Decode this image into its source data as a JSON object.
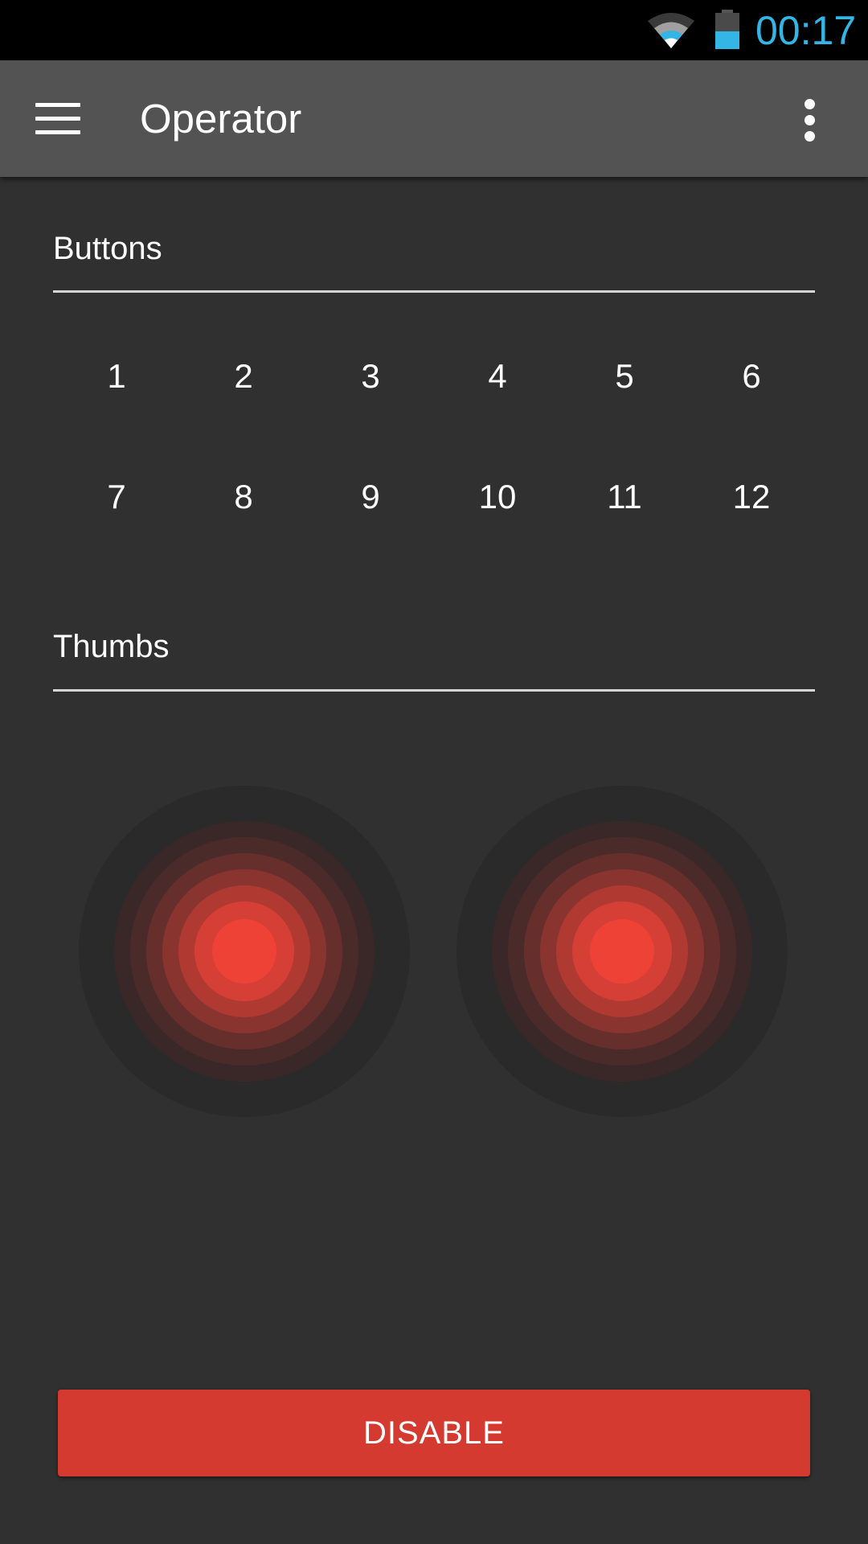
{
  "status_bar": {
    "time": "00:17",
    "icons": [
      "wifi-icon",
      "battery-icon"
    ],
    "accent_color": "#33b5e5"
  },
  "app_bar": {
    "title": "Operator",
    "menu_icon": "hamburger-menu-icon",
    "overflow_icon": "more-vert-icon"
  },
  "buttons_section": {
    "title": "Buttons",
    "buttons": [
      "1",
      "2",
      "3",
      "4",
      "5",
      "6",
      "7",
      "8",
      "9",
      "10",
      "11",
      "12"
    ]
  },
  "thumbs_section": {
    "title": "Thumbs",
    "thumbs": [
      "left-thumbstick",
      "right-thumbstick"
    ],
    "thumb_color": "#f44336"
  },
  "action": {
    "disable_label": "DISABLE",
    "color": "#d43a2f"
  }
}
